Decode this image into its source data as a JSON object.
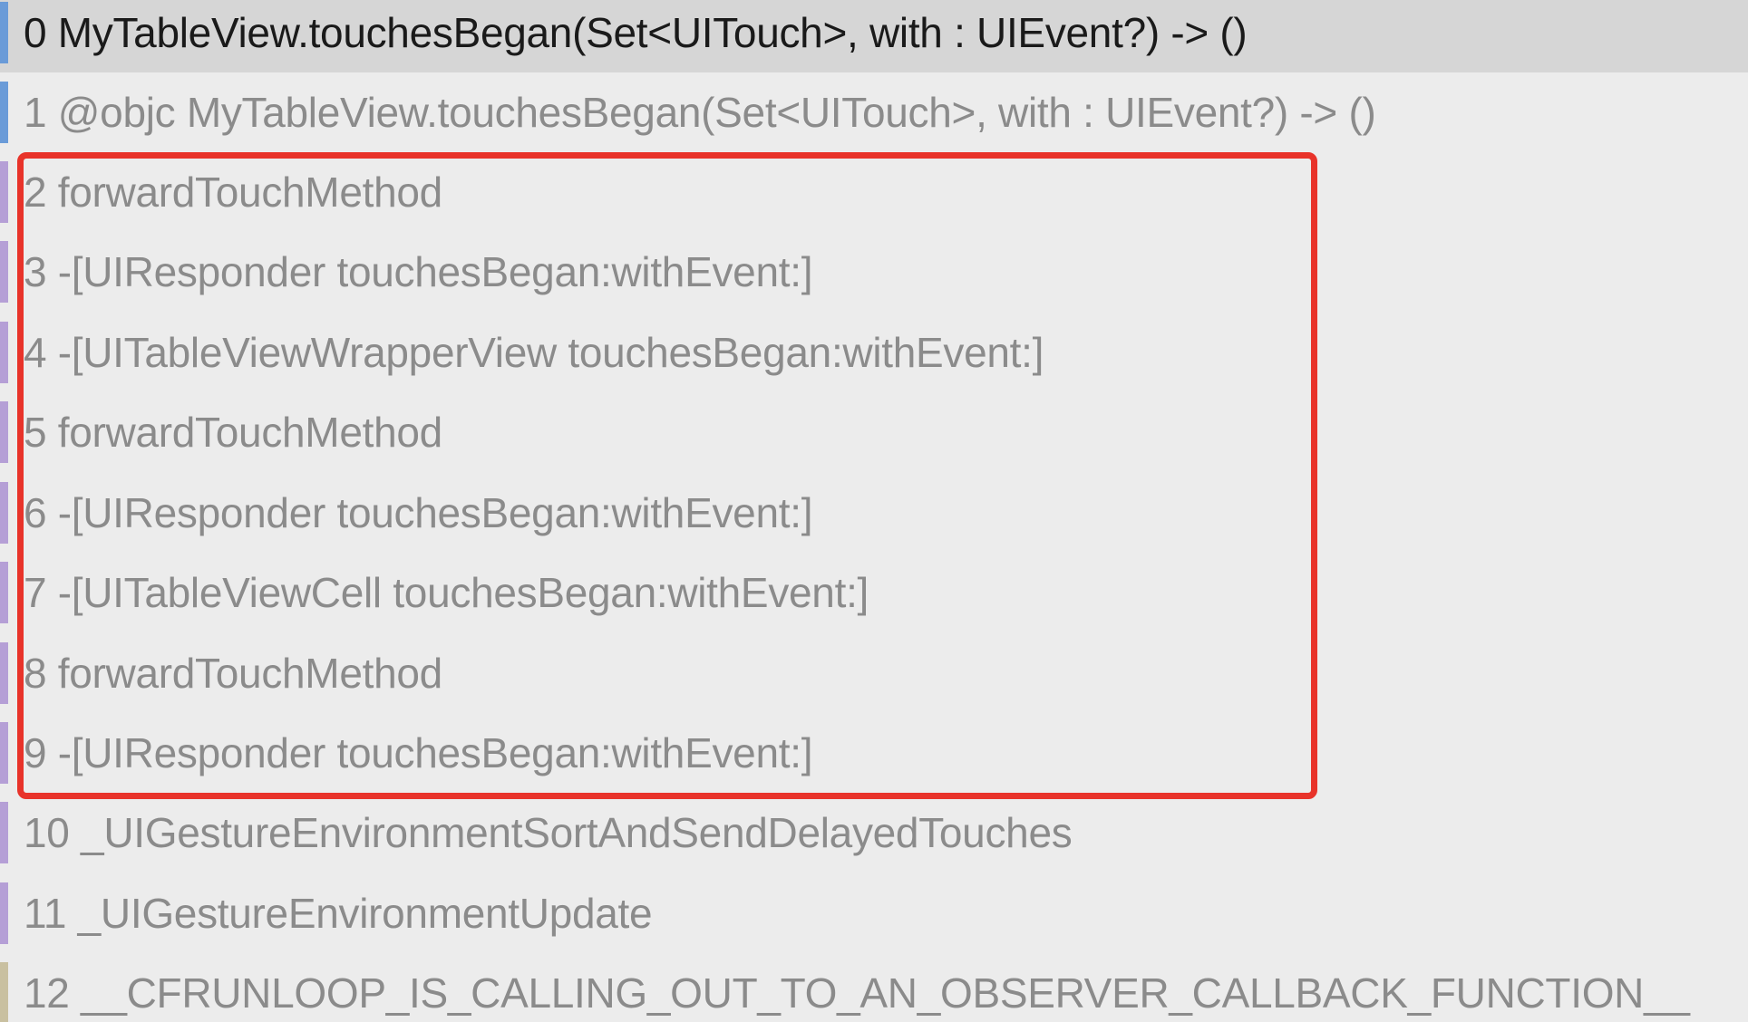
{
  "colors": {
    "background": "#ececec",
    "selected_row": "#d6d6d6",
    "highlight_border": "#e8332a",
    "bar_user_frame": "#6a9bd8",
    "bar_system_frame": "#b59fd6",
    "bar_runloop_frame": "#c9c0a0"
  },
  "frames": [
    {
      "text": "0 MyTableView.touchesBegan(Set<UITouch>, with : UIEvent?) -> ()",
      "bar": "#6a9bd8",
      "selected": true
    },
    {
      "text": "1 @objc MyTableView.touchesBegan(Set<UITouch>, with : UIEvent?) -> ()",
      "bar": "#6a9bd8",
      "selected": false
    },
    {
      "text": "2 forwardTouchMethod",
      "bar": "#b59fd6",
      "selected": false
    },
    {
      "text": "3 -[UIResponder touchesBegan:withEvent:]",
      "bar": "#b59fd6",
      "selected": false
    },
    {
      "text": "4 -[UITableViewWrapperView touchesBegan:withEvent:]",
      "bar": "#b59fd6",
      "selected": false
    },
    {
      "text": "5 forwardTouchMethod",
      "bar": "#b59fd6",
      "selected": false
    },
    {
      "text": "6 -[UIResponder touchesBegan:withEvent:]",
      "bar": "#b59fd6",
      "selected": false
    },
    {
      "text": "7 -[UITableViewCell touchesBegan:withEvent:]",
      "bar": "#b59fd6",
      "selected": false
    },
    {
      "text": "8 forwardTouchMethod",
      "bar": "#b59fd6",
      "selected": false
    },
    {
      "text": "9 -[UIResponder touchesBegan:withEvent:]",
      "bar": "#b59fd6",
      "selected": false
    },
    {
      "text": "10 _UIGestureEnvironmentSortAndSendDelayedTouches",
      "bar": "#b59fd6",
      "selected": false
    },
    {
      "text": "11 _UIGestureEnvironmentUpdate",
      "bar": "#b59fd6",
      "selected": false
    },
    {
      "text": "12 __CFRUNLOOP_IS_CALLING_OUT_TO_AN_OBSERVER_CALLBACK_FUNCTION__",
      "bar": "#c9c0a0",
      "selected": false
    }
  ]
}
